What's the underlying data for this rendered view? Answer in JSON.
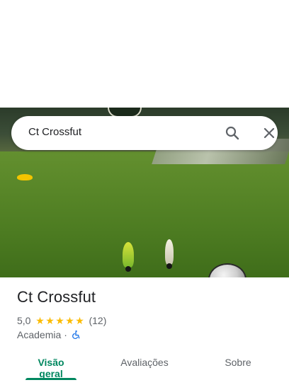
{
  "search": {
    "value": "Ct Crossfut"
  },
  "place": {
    "name": "Ct Crossfut",
    "rating": "5,0",
    "stars": 5,
    "review_count": "(12)",
    "category": "Academia",
    "separator": "·",
    "accessibility_icon": "wheelchair-icon"
  },
  "tabs": [
    {
      "label": "Visão geral",
      "active": true
    },
    {
      "label": "Avaliações",
      "active": false
    },
    {
      "label": "Sobre",
      "active": false
    }
  ],
  "colors": {
    "accent": "#01875f",
    "star": "#fbbc04",
    "accessibility": "#1a73e8"
  }
}
